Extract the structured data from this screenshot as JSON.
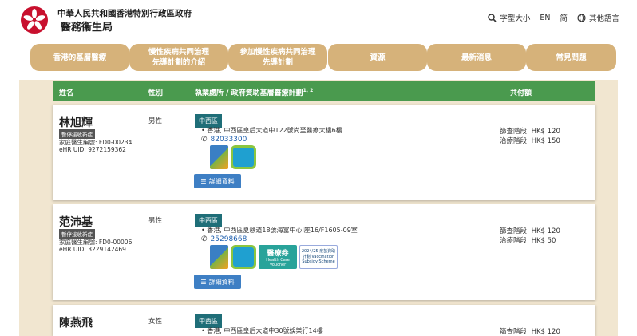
{
  "header": {
    "gov_title": "中華人民共和國香港特別行政區政府",
    "dept_title": "醫務衞生局",
    "font_size_label": "字型大小",
    "lang_en": "EN",
    "lang_sc": "简",
    "other_langs": "其他語言"
  },
  "nav": [
    {
      "lines": [
        "香港的基層醫療"
      ]
    },
    {
      "lines": [
        "慢性疾病共同治理",
        "先導計劃的介紹"
      ]
    },
    {
      "lines": [
        "參加慢性疾病共同治理",
        "先導計劃"
      ]
    },
    {
      "lines": [
        "資源"
      ]
    },
    {
      "lines": [
        "最新消息"
      ]
    },
    {
      "lines": [
        "常見問題"
      ]
    }
  ],
  "table": {
    "col_name": "姓名",
    "col_gender": "性別",
    "col_practice": "執業處所 / 政府資助基層醫療計劃",
    "col_practice_sup": "1, 2",
    "col_copay": "共付額"
  },
  "doctors": [
    {
      "name": "林旭輝",
      "badge": "暫停接收新症",
      "family_id": "家庭醫生編號: FD0-00234",
      "ehr_uid": "eHR UID: 9272159362",
      "gender": "男性",
      "district": "中西區",
      "address": "香港, 中西區皇后大道中122號尚至醫療大樓6樓",
      "phone": "82033300",
      "detail_label": "詳細資料",
      "fee_screen": "篩查階段: HK$ 120",
      "fee_treat": "治療階段: HK$ 150",
      "scheme_logos": [
        "chronic-disease-logo",
        "elderly-logo"
      ]
    },
    {
      "name": "范沛基",
      "badge": "暫停接收新症",
      "family_id": "家庭醫生編號: FD0-00006",
      "ehr_uid": "eHR UID: 3229142469",
      "gender": "男性",
      "district": "中西區",
      "address": "香港, 中西區夏慤道18號海富中心I座16/F1605-09室",
      "phone": "25298668",
      "detail_label": "詳細資料",
      "fee_screen": "篩查階段: HK$ 120",
      "fee_treat": "治療階段: HK$   50",
      "voucher_title": "醫療券",
      "voucher_sub": "Health Care Voucher",
      "vaccination_logo_text": "2024/25 疫苗資助計劃 Vaccination Subsidy Scheme",
      "scheme_logos": [
        "chronic-disease-logo",
        "elderly-logo",
        "health-care-voucher-logo",
        "vaccination-scheme-logo"
      ]
    },
    {
      "name": "陳燕飛",
      "gender": "女性",
      "district": "中西區",
      "address": "香港, 中西區皇后大道中30號娛樂行14樓",
      "fee_screen": "篩查階段: HK$ 120"
    }
  ]
}
